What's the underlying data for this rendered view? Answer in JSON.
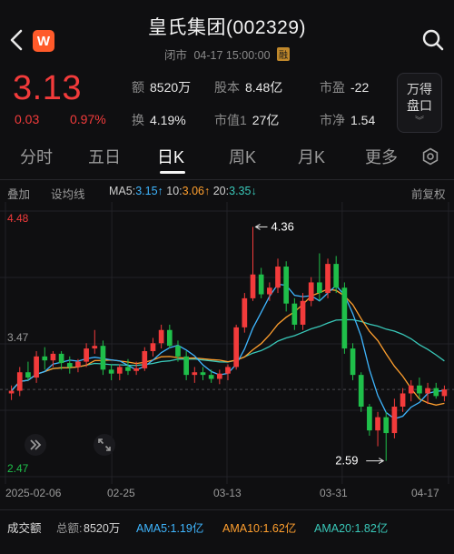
{
  "header": {
    "title": "皇氏集团(002329)",
    "status": "闭市",
    "datetime": "04-17 15:00:00",
    "margin_badge": "融",
    "brand_letter": "W"
  },
  "quote": {
    "price": "3.13",
    "change": "0.03",
    "change_pct": "0.97%",
    "stats": [
      {
        "label": "额",
        "value": "8520万"
      },
      {
        "label": "股本",
        "value": "8.48亿"
      },
      {
        "label": "市盈",
        "value": "-22"
      },
      {
        "label": "换",
        "value": "4.19%"
      },
      {
        "label": "市值1",
        "value": "27亿"
      },
      {
        "label": "市净",
        "value": "1.54"
      }
    ],
    "order_book_button": [
      "万得",
      "盘口"
    ],
    "up_color": "#f23b3b"
  },
  "tabs": {
    "items": [
      "分时",
      "五日",
      "日K",
      "周K",
      "月K",
      "更多"
    ],
    "active": "日K"
  },
  "toolbar": {
    "adjust": "叠加",
    "draw": "设均线",
    "restoration": "前复权"
  },
  "ma": {
    "ma5_label": "MA5:",
    "ma5_value": "3.15",
    "ma5_arrow": "↑",
    "ma10_label": "10:",
    "ma10_value": "3.06",
    "ma10_arrow": "↑",
    "ma20_label": "20:",
    "ma20_value": "3.35",
    "ma20_arrow": "↓",
    "ma5_color": "#3fb6ff",
    "ma10_color": "#ff9f2e",
    "ma20_color": "#39c8b9"
  },
  "chart_data": {
    "type": "candlestick",
    "y_labels": {
      "top": "4.48",
      "mid": "3.47",
      "bottom": "2.47"
    },
    "ylim": [
      2.47,
      4.48
    ],
    "x_tick_labels": [
      "2025-02-06",
      "02-25",
      "03-13",
      "03-31",
      "04-17"
    ],
    "high_annotation": "4.36",
    "low_annotation": "2.59",
    "ohlc": [
      [
        3.1,
        3.16,
        3.05,
        3.12
      ],
      [
        3.12,
        3.3,
        3.08,
        3.26
      ],
      [
        3.26,
        3.34,
        3.2,
        3.22
      ],
      [
        3.22,
        3.42,
        3.18,
        3.38
      ],
      [
        3.38,
        3.45,
        3.28,
        3.35
      ],
      [
        3.35,
        3.42,
        3.3,
        3.4
      ],
      [
        3.4,
        3.42,
        3.28,
        3.33
      ],
      [
        3.33,
        3.38,
        3.25,
        3.3
      ],
      [
        3.3,
        3.36,
        3.26,
        3.34
      ],
      [
        3.34,
        3.48,
        3.3,
        3.44
      ],
      [
        3.44,
        3.58,
        3.4,
        3.46
      ],
      [
        3.46,
        3.5,
        3.24,
        3.28
      ],
      [
        3.28,
        3.32,
        3.2,
        3.25
      ],
      [
        3.25,
        3.32,
        3.2,
        3.3
      ],
      [
        3.3,
        3.36,
        3.24,
        3.27
      ],
      [
        3.27,
        3.34,
        3.24,
        3.29
      ],
      [
        3.29,
        3.45,
        3.27,
        3.42
      ],
      [
        3.42,
        3.52,
        3.38,
        3.48
      ],
      [
        3.48,
        3.62,
        3.44,
        3.58
      ],
      [
        3.58,
        3.62,
        3.44,
        3.46
      ],
      [
        3.46,
        3.5,
        3.34,
        3.38
      ],
      [
        3.38,
        3.42,
        3.2,
        3.24
      ],
      [
        3.24,
        3.3,
        3.18,
        3.26
      ],
      [
        3.26,
        3.3,
        3.2,
        3.24
      ],
      [
        3.24,
        3.28,
        3.18,
        3.21
      ],
      [
        3.21,
        3.28,
        3.17,
        3.25
      ],
      [
        3.25,
        3.32,
        3.2,
        3.3
      ],
      [
        3.3,
        3.62,
        3.28,
        3.6
      ],
      [
        3.6,
        3.86,
        3.56,
        3.82
      ],
      [
        3.82,
        4.36,
        3.8,
        4.0
      ],
      [
        4.0,
        4.05,
        3.82,
        3.85
      ],
      [
        3.85,
        3.94,
        3.8,
        3.9
      ],
      [
        3.9,
        4.12,
        3.86,
        4.06
      ],
      [
        4.06,
        4.1,
        3.72,
        3.78
      ],
      [
        3.78,
        3.82,
        3.58,
        3.62
      ],
      [
        3.62,
        3.86,
        3.58,
        3.8
      ],
      [
        3.8,
        3.98,
        3.76,
        3.94
      ],
      [
        3.94,
        4.16,
        3.8,
        3.86
      ],
      [
        3.86,
        4.12,
        3.82,
        4.08
      ],
      [
        4.08,
        4.14,
        3.86,
        3.9
      ],
      [
        3.9,
        3.94,
        3.4,
        3.44
      ],
      [
        3.44,
        3.48,
        3.2,
        3.24
      ],
      [
        3.24,
        3.26,
        2.96,
        3.0
      ],
      [
        3.0,
        3.02,
        2.78,
        2.82
      ],
      [
        2.82,
        2.96,
        2.7,
        2.92
      ],
      [
        2.92,
        2.96,
        2.59,
        2.8
      ],
      [
        2.8,
        3.06,
        2.76,
        3.0
      ],
      [
        3.0,
        3.14,
        2.96,
        3.1
      ],
      [
        3.1,
        3.2,
        3.04,
        3.16
      ],
      [
        3.16,
        3.22,
        3.06,
        3.1
      ],
      [
        3.1,
        3.18,
        3.02,
        3.14
      ],
      [
        3.14,
        3.18,
        3.06,
        3.08
      ],
      [
        3.08,
        3.16,
        3.04,
        3.13
      ]
    ]
  },
  "volume": {
    "title": "成交额",
    "total_label": "总额:",
    "total_value": "8520万",
    "ama5": "AMA5:1.19亿",
    "ama10": "AMA10:1.62亿",
    "ama20": "AMA20:1.82亿"
  },
  "colors": {
    "up": "#f23b3b",
    "down": "#1fbf4a",
    "ama10": "#ff9f2e",
    "ama20": "#39c8b9",
    "ama5": "#3fb6ff"
  }
}
